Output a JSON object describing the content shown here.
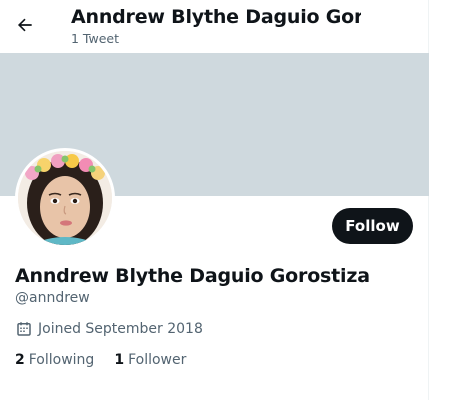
{
  "header": {
    "back_icon": "arrow-left-icon",
    "title": "Anndrew Blythe Daguio Gor...",
    "tweet_count": "1 Tweet"
  },
  "profile": {
    "display_name": "Anndrew Blythe Daguio Gorostiza",
    "handle": "@anndrew",
    "joined_icon": "calendar-icon",
    "joined": "Joined September 2018",
    "following_count": "2",
    "following_label": "Following",
    "followers_count": "1",
    "followers_label": "Follower"
  },
  "actions": {
    "follow_label": "Follow"
  },
  "colors": {
    "banner": "#cfd9de",
    "text_primary": "#0f1419",
    "text_secondary": "#536471",
    "follow_button": "#0f1419"
  }
}
